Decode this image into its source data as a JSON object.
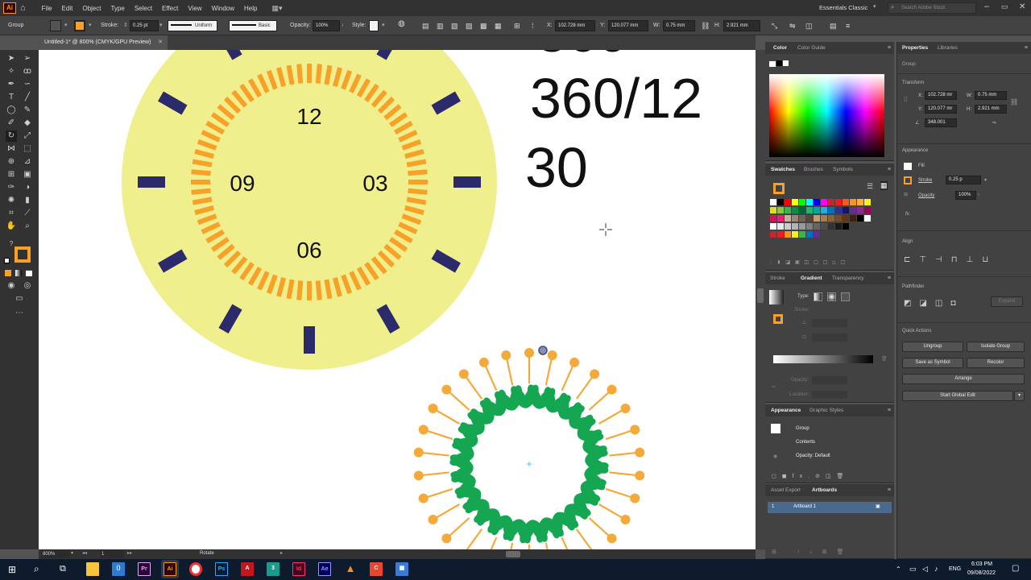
{
  "app": {
    "logo": "Ai"
  },
  "menus": [
    "File",
    "Edit",
    "Object",
    "Type",
    "Select",
    "Effect",
    "View",
    "Window",
    "Help"
  ],
  "workspace": "Essentials Classic",
  "search_placeholder": "Search Adobe Stock",
  "control_bar": {
    "selection": "Group",
    "stroke_label": "Stroke:",
    "stroke_weight": "0.25 pt",
    "profile": "Uniform",
    "brush": "Basic",
    "opacity_label": "Opacity:",
    "opacity": "100%",
    "style_label": "Style:",
    "x_label": "X:",
    "x": "102.728 mm",
    "y_label": "Y:",
    "y": "120.077 mm",
    "w_label": "W:",
    "w": "0.75 mm",
    "h_label": "H:",
    "h": "2.921 mm"
  },
  "document_tab": "Untitled-1* @ 800% (CMYK/GPU Preview)",
  "canvas": {
    "clock_numbers": {
      "twelve": "12",
      "three": "03",
      "six": "06",
      "nine": "09"
    },
    "big_text": {
      "line1": "360/12",
      "line2": "30"
    }
  },
  "status": {
    "zoom": "800%",
    "artboard": "1",
    "tool": "Rotate"
  },
  "color_panel": {
    "tabs": [
      "Color",
      "Color Guide"
    ]
  },
  "swatches_panel": {
    "tabs": [
      "Swatches",
      "Brushes",
      "Symbols"
    ]
  },
  "gradient_panel": {
    "tabs": [
      "Stroke",
      "Gradient",
      "Transparency"
    ],
    "type_label": "Type:",
    "stroke_label": "Stroke:",
    "opacity_label": "Opacity:",
    "location_label": "Location:"
  },
  "appearance_panel": {
    "tabs": [
      "Appearance",
      "Graphic Styles"
    ],
    "group": "Group",
    "contents": "Contents",
    "opacity": "Opacity: Default"
  },
  "artboards_panel": {
    "tabs": [
      "Asset Export",
      "Artboards"
    ],
    "row_num": "1",
    "row_name": "Artboard 1"
  },
  "properties": {
    "tabs": [
      "Properties",
      "Libraries"
    ],
    "selection": "Group",
    "transform_title": "Transform",
    "x_label": "X:",
    "x": "102.728 mr",
    "y_label": "Y:",
    "y": "120.077 mr",
    "w_label": "W:",
    "w": "0.75 mm",
    "h_label": "H:",
    "h": "2.921 mm",
    "angle": "348.001",
    "appearance_title": "Appearance",
    "fill_label": "Fill",
    "stroke_label": "Stroke",
    "stroke_value": "0.25 p",
    "opacity_label": "Opacity",
    "opacity_value": "100%",
    "fx": "fx.",
    "align_title": "Align",
    "pathfinder_title": "Pathfinder",
    "expand_label": "Expand",
    "quick_actions_title": "Quick Actions",
    "ungroup": "Ungroup",
    "isolate_group": "Isolate Group",
    "save_as_symbol": "Save as Symbol",
    "recolor": "Recolor",
    "arrange": "Arrange",
    "start_global_edit": "Start Global Edit"
  },
  "taskbar": {
    "apps": [
      "Pr",
      "Ai",
      "Ps",
      "Id",
      "Ae"
    ],
    "lang": "ENG",
    "time": "6:03 PM",
    "date": "09/08/2022"
  },
  "colors": {
    "sun": "#f0ef8d",
    "orange": "#f7a128",
    "navy": "#2b2a6b",
    "leaf": "#14a651",
    "petal": "#f4a93b"
  }
}
